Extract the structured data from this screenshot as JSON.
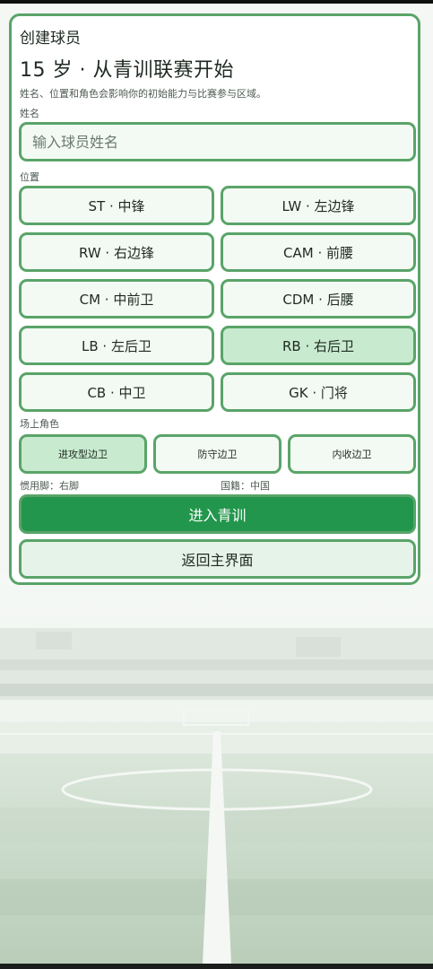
{
  "header": {
    "eyebrow": "创建球员",
    "headline": "15 岁 · 从青训联赛开始",
    "description": "姓名、位置和角色会影响你的初始能力与比赛参与区域。"
  },
  "name_field": {
    "label": "姓名",
    "placeholder": "输入球员姓名",
    "value": ""
  },
  "positions": {
    "label": "位置",
    "selected": "RB · 右后卫",
    "items": [
      {
        "label": "ST · 中锋"
      },
      {
        "label": "LW · 左边锋"
      },
      {
        "label": "RW · 右边锋"
      },
      {
        "label": "CAM · 前腰"
      },
      {
        "label": "CM · 中前卫"
      },
      {
        "label": "CDM · 后腰"
      },
      {
        "label": "LB · 左后卫"
      },
      {
        "label": "RB · 右后卫"
      },
      {
        "label": "CB · 中卫"
      },
      {
        "label": "GK · 门将"
      }
    ]
  },
  "roles": {
    "label": "场上角色",
    "selected": "进攻型边卫",
    "items": [
      {
        "label": "进攻型边卫"
      },
      {
        "label": "防守边卫"
      },
      {
        "label": "内收边卫"
      }
    ]
  },
  "info": {
    "foot": "惯用脚：右脚",
    "nationality": "国籍：中国"
  },
  "actions": {
    "primary": "进入青训",
    "secondary": "返回主界面"
  },
  "colors": {
    "accent_border": "#5aa469",
    "primary_button": "#22964c",
    "selected_fill": "#c8ebcf",
    "button_fill": "#f3faf4"
  }
}
